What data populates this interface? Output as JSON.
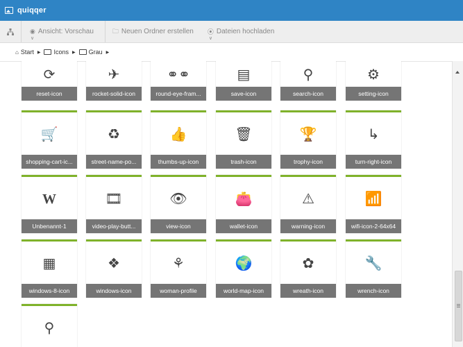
{
  "window": {
    "title": "quiqqer",
    "accent": "#2f84c5"
  },
  "toolbar": {
    "view_label": "Ansicht: Vorschau",
    "new_folder_label": "Neuen Ordner erstellen",
    "upload_label": "Dateien hochladen"
  },
  "breadcrumb": [
    "Start",
    "Icons",
    "Grau"
  ],
  "tile_accent": "#7fb22a",
  "tiles": [
    {
      "label": "reset-icon",
      "icon": "reset-icon"
    },
    {
      "label": "rocket-solid-icon",
      "icon": "rocket-icon"
    },
    {
      "label": "round-eye-fram...",
      "icon": "glasses-icon"
    },
    {
      "label": "save-icon",
      "icon": "save-icon"
    },
    {
      "label": "search-icon",
      "icon": "search-icon"
    },
    {
      "label": "setting-icon",
      "icon": "gear-icon"
    },
    {
      "label": "shopping-cart-ic...",
      "icon": "cart-icon"
    },
    {
      "label": "street-name-po...",
      "icon": "signpost-icon"
    },
    {
      "label": "thumbs-up-icon",
      "icon": "thumbs-up-icon"
    },
    {
      "label": "trash-icon",
      "icon": "trash-icon"
    },
    {
      "label": "trophy-icon",
      "icon": "trophy-icon"
    },
    {
      "label": "turn-right-icon",
      "icon": "turn-right-icon"
    },
    {
      "label": "Unbenannt-1",
      "icon": "w-letter-icon"
    },
    {
      "label": "video-play-butt...",
      "icon": "film-icon"
    },
    {
      "label": "view-icon",
      "icon": "eye-icon"
    },
    {
      "label": "wallet-icon",
      "icon": "wallet-icon"
    },
    {
      "label": "warning-icon",
      "icon": "warning-icon"
    },
    {
      "label": "wifi-icon-2-64x64",
      "icon": "wifi-icon"
    },
    {
      "label": "windows-8-icon",
      "icon": "windows-8-icon"
    },
    {
      "label": "windows-icon",
      "icon": "windows-icon"
    },
    {
      "label": "woman-profile",
      "icon": "woman-profile-icon"
    },
    {
      "label": "world-map-icon",
      "icon": "world-map-icon"
    },
    {
      "label": "wreath-icon",
      "icon": "wreath-icon"
    },
    {
      "label": "wrench-icon",
      "icon": "wrench-icon"
    },
    {
      "label": "",
      "icon": "search-refresh-icon"
    }
  ]
}
